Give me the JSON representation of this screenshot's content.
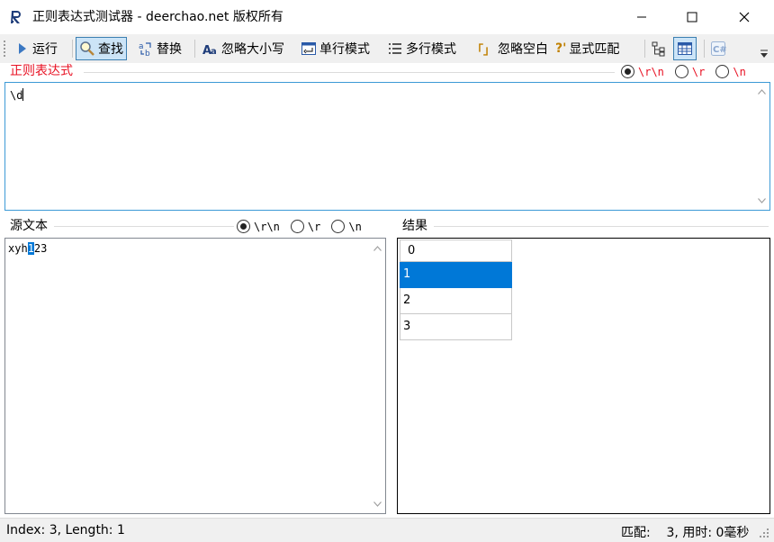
{
  "window": {
    "title": "正则表达式测试器 - deerchao.net 版权所有",
    "icon": "app-r-icon"
  },
  "toolbar": {
    "run_label": "运行",
    "find_label": "查找",
    "replace_label": "替换",
    "ignore_case_label": "忽略大小写",
    "single_line_label": "单行模式",
    "multi_line_label": "多行模式",
    "ignore_space_label": "忽略空白",
    "explicit_capture_label": "显式匹配",
    "ignore_space_glyph": "「」",
    "explicit_capture_glyph": "?'",
    "ignore_case_glyph": "Aa"
  },
  "regex": {
    "label": "正则表达式",
    "value": "\\d",
    "newline_options": [
      "\\r\\n",
      "\\r",
      "\\n"
    ],
    "newline_selected": 0
  },
  "source": {
    "label": "源文本",
    "text_before": "xyh",
    "text_selected": "1",
    "text_after": "23",
    "newline_options": [
      "\\r\\n",
      "\\r",
      "\\n"
    ],
    "newline_selected": 0
  },
  "results": {
    "label": "结果",
    "rows": [
      "0",
      "1",
      "2",
      "3"
    ],
    "selected_index": 1
  },
  "status": {
    "left": "Index: 3, Length: 1",
    "right": "匹配:    3, 用时: 0毫秒"
  },
  "colors": {
    "accent": "#0078d7",
    "regex_label": "#e81123",
    "focus_border": "#3c9ad6"
  }
}
